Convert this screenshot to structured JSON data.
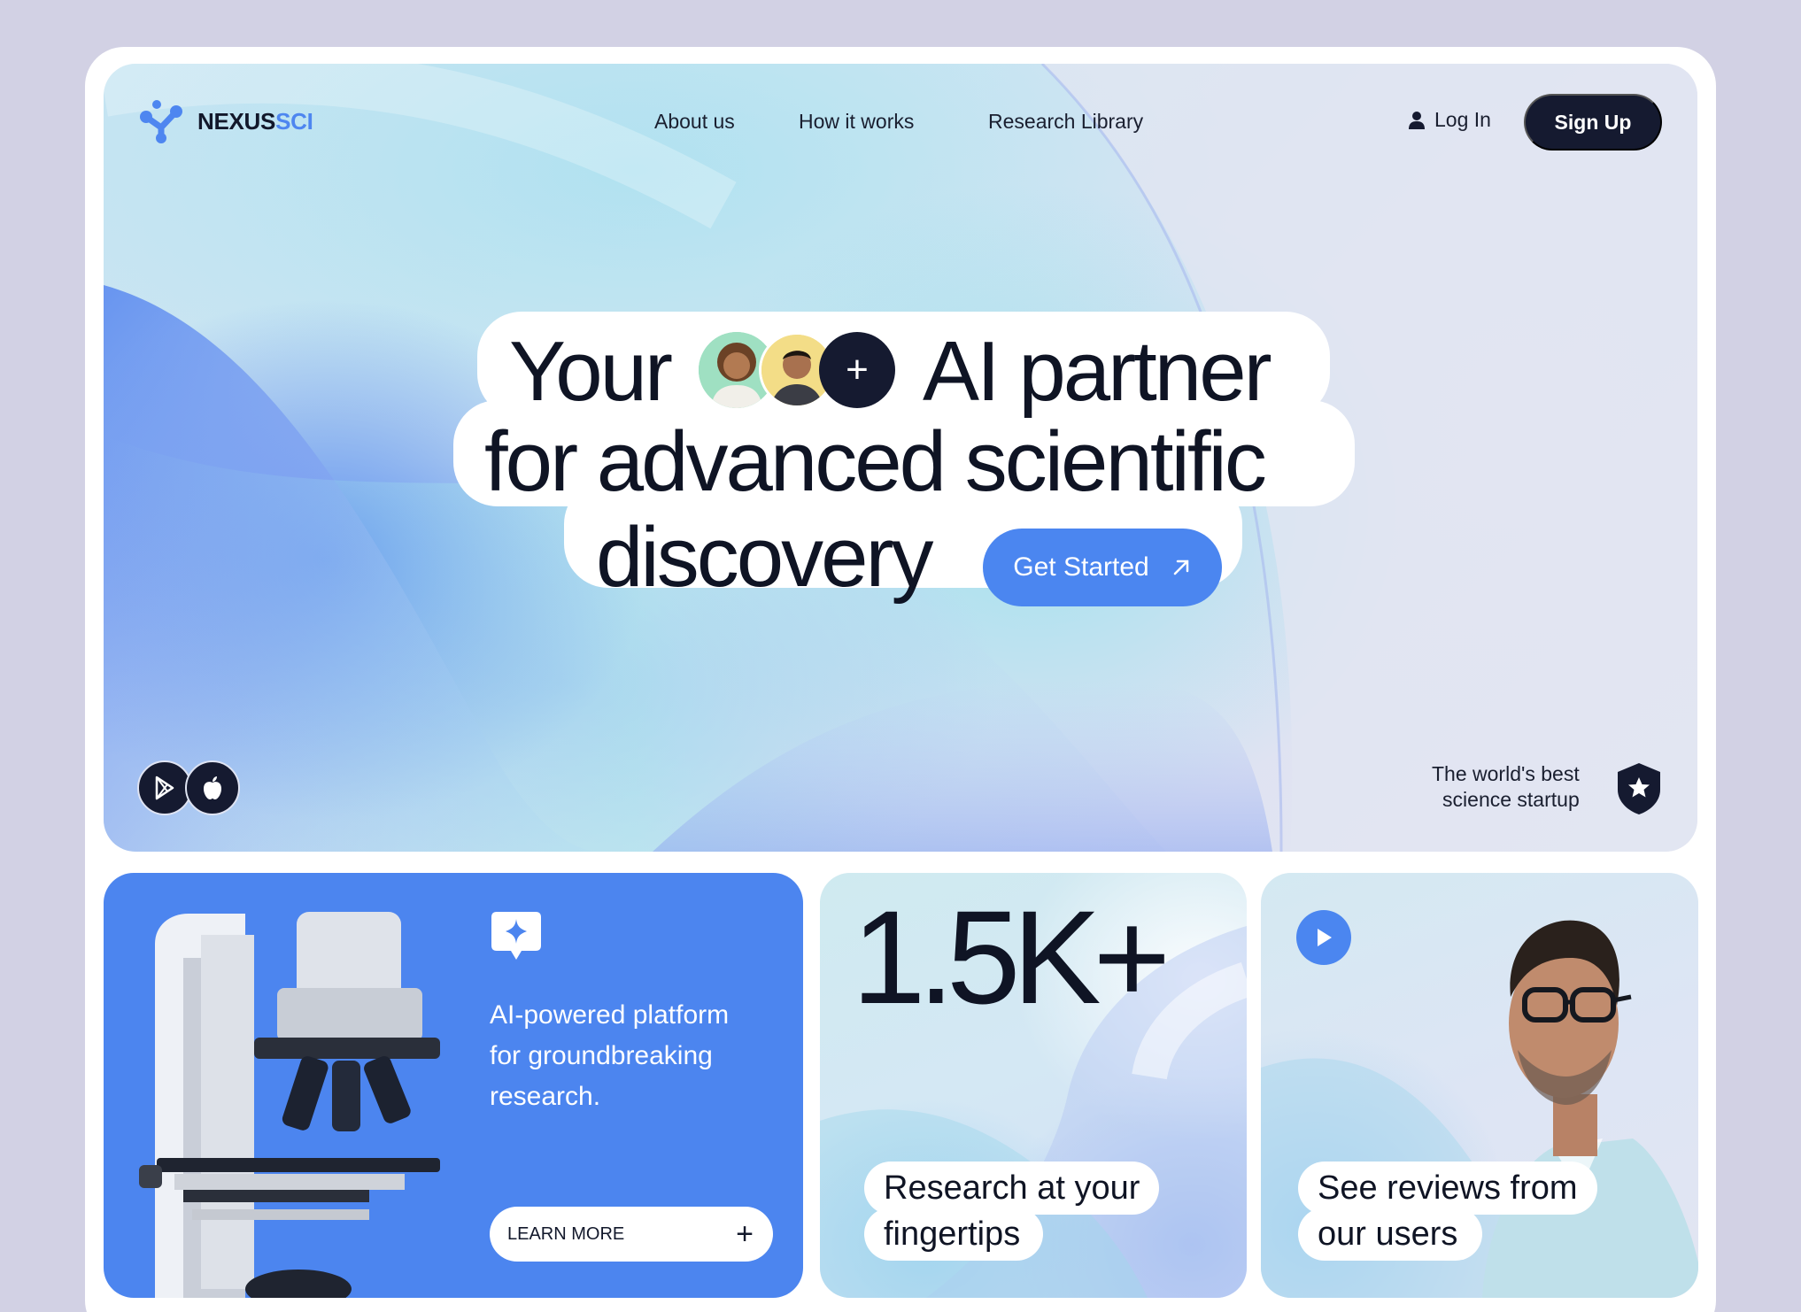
{
  "brand": {
    "name_a": "NEXUS",
    "name_b": "SCI"
  },
  "nav": {
    "links": [
      "About us",
      "How it works",
      "Research Library"
    ],
    "login_label": "Log In",
    "signup_label": "Sign Up"
  },
  "hero": {
    "line1_a": "Your",
    "line1_b": "AI partner",
    "line2": "for advanced scientific",
    "line3": "discovery",
    "plus_symbol": "+",
    "cta_label": "Get Started",
    "award_line1": "The world's best",
    "award_line2": "science startup"
  },
  "cards": {
    "platform": {
      "text_line1": "AI-powered platform",
      "text_line2": "for groundbreaking",
      "text_line3": "research.",
      "button_label": "LEARN MORE",
      "button_symbol": "+"
    },
    "stat": {
      "value": "1.5K+",
      "caption_line1": "Research at your",
      "caption_line2": "fingertips"
    },
    "reviews": {
      "caption_line1": "See reviews from",
      "caption_line2": "our users"
    }
  },
  "icons": [
    "molecule-logo-icon",
    "user-icon",
    "arrow-up-right-icon",
    "google-play-icon",
    "apple-icon",
    "shield-star-icon",
    "sparkle-chat-icon",
    "play-icon"
  ],
  "colors": {
    "accent": "#4b86f0",
    "dark": "#151a30",
    "background": "#d2d1e4"
  }
}
